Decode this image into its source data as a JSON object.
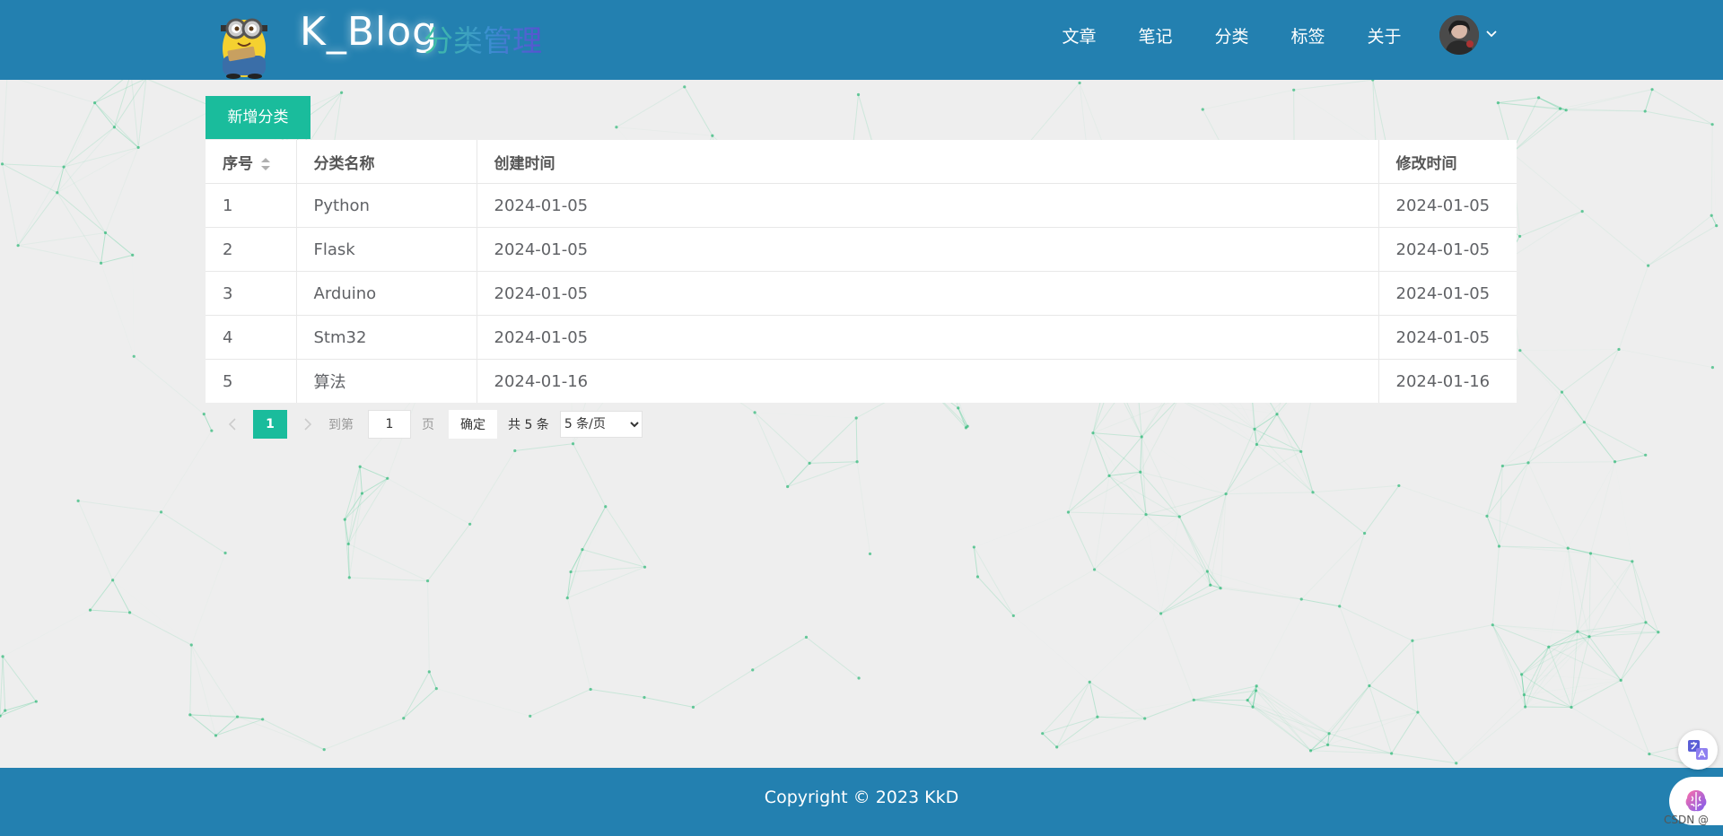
{
  "header": {
    "brand": "K_Blog",
    "subtitle": "分类管理",
    "nav": [
      {
        "label": "文章"
      },
      {
        "label": "笔记"
      },
      {
        "label": "分类"
      },
      {
        "label": "标签"
      },
      {
        "label": "关于"
      }
    ],
    "icons": {
      "logo": "minion-mascot-logo",
      "avatar": "user-avatar",
      "chevron": "chevron-down-icon"
    }
  },
  "toolbar": {
    "add_label": "新增分类"
  },
  "table": {
    "headers": {
      "index": "序号",
      "name": "分类名称",
      "created": "创建时间",
      "modified": "修改时间"
    },
    "rows": [
      {
        "index": "1",
        "name": "Python",
        "created": "2024-01-05",
        "modified": "2024-01-05"
      },
      {
        "index": "2",
        "name": "Flask",
        "created": "2024-01-05",
        "modified": "2024-01-05"
      },
      {
        "index": "3",
        "name": "Arduino",
        "created": "2024-01-05",
        "modified": "2024-01-05"
      },
      {
        "index": "4",
        "name": "Stm32",
        "created": "2024-01-05",
        "modified": "2024-01-05"
      },
      {
        "index": "5",
        "name": "算法",
        "created": "2024-01-16",
        "modified": "2024-01-16"
      }
    ]
  },
  "pagination": {
    "current_page": "1",
    "jump_to_label": "到第",
    "jump_value": "1",
    "page_unit": "页",
    "confirm_label": "确定",
    "total": "共 5 条",
    "page_size": "5 条/页"
  },
  "footer": {
    "copyright": "Copyright  ©  2023  KkD"
  },
  "watermark": "CSDN @"
}
